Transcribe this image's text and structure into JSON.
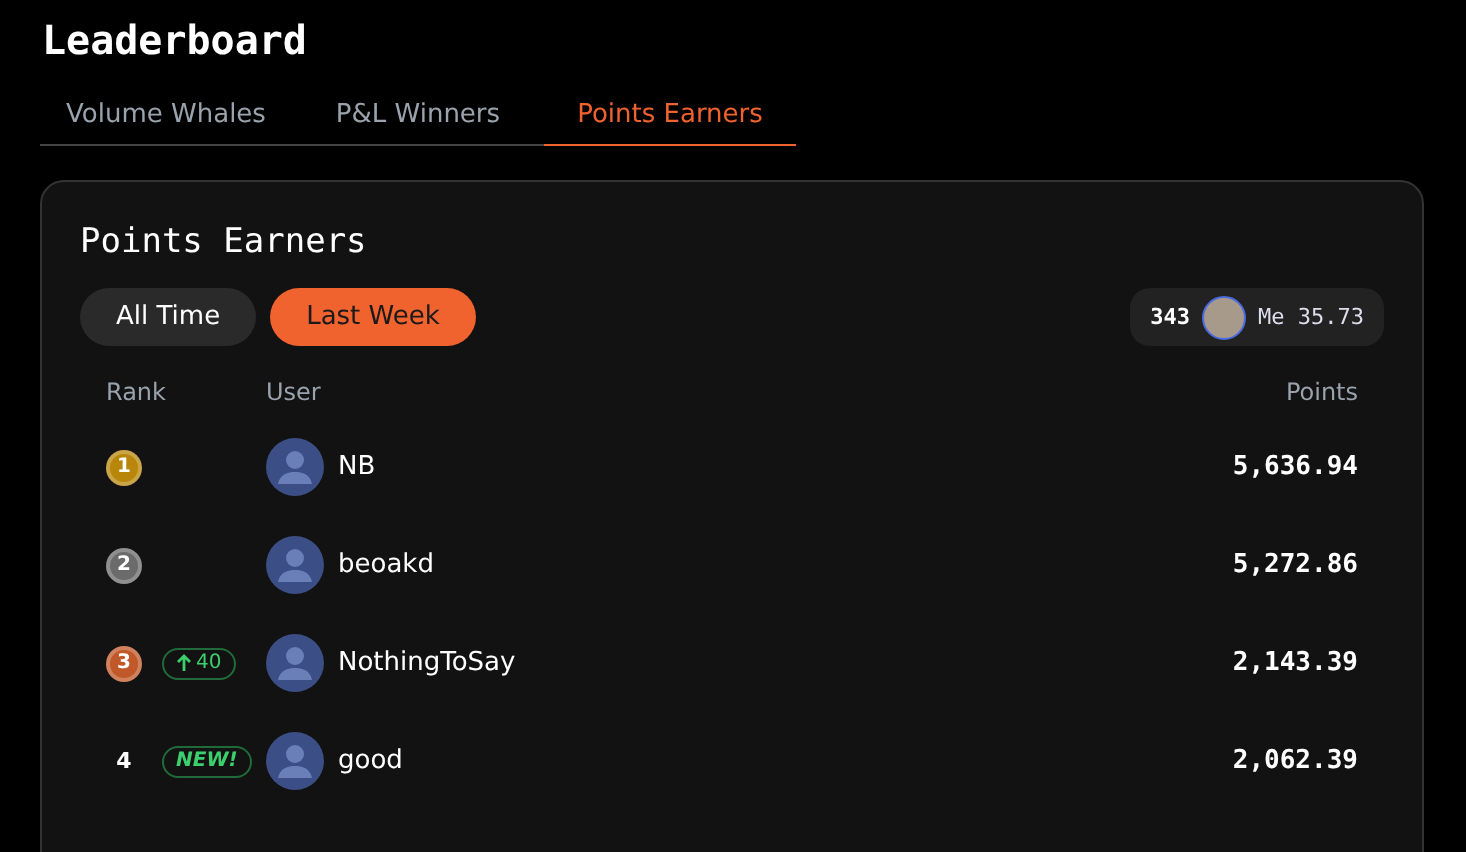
{
  "title": "Leaderboard",
  "tabs": [
    {
      "label": "Volume Whales",
      "selected": false
    },
    {
      "label": "P&L Winners",
      "selected": false
    },
    {
      "label": "Points Earners",
      "selected": true
    }
  ],
  "card": {
    "title": "Points Earners",
    "periods": [
      {
        "label": "All Time",
        "selected": false
      },
      {
        "label": "Last Week",
        "selected": true
      }
    ],
    "me": {
      "rank": "343",
      "label": "Me 35.73"
    },
    "columns": [
      "Rank",
      "User",
      "Points"
    ],
    "rows": [
      {
        "rank": "1",
        "kind": "medal",
        "color": "#b8860b",
        "name": "NB",
        "points": "5,636.94"
      },
      {
        "rank": "2",
        "kind": "medal",
        "color": "#6b6b6b",
        "name": "beoakd",
        "points": "5,272.86"
      },
      {
        "rank": "3",
        "kind": "medal",
        "color": "#c0582a",
        "name": "NothingToSay",
        "points": "2,143.39",
        "change": {
          "kind": "up",
          "text": "40"
        }
      },
      {
        "rank": "4",
        "kind": "plain",
        "name": "good",
        "points": "2,062.39",
        "change": {
          "kind": "new",
          "text": "NEW!"
        }
      }
    ]
  }
}
